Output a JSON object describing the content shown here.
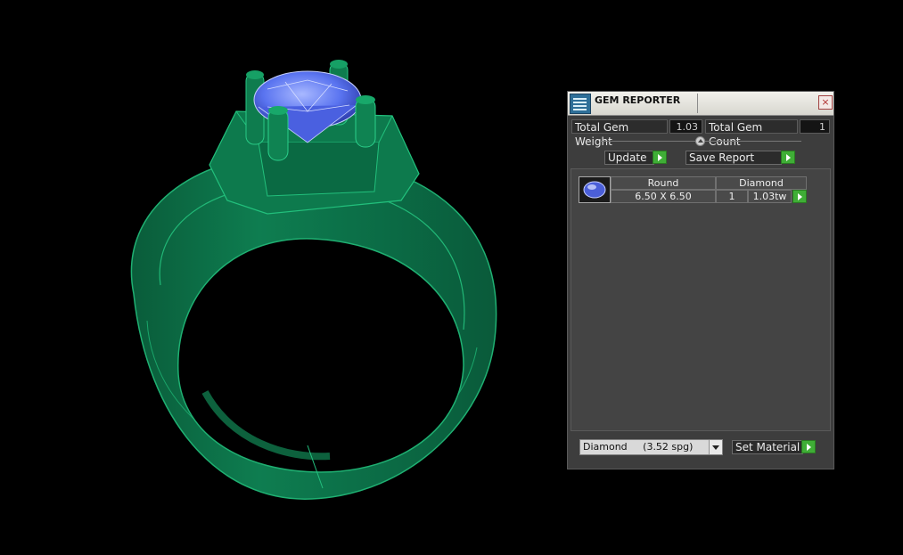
{
  "window": {
    "title": "GEM REPORTER",
    "close_label": "×"
  },
  "summary": {
    "weight_label": "Total Gem Weight",
    "weight_value": "1.03",
    "count_label": "Total Gem Count",
    "count_value": "1"
  },
  "actions": {
    "update_label": "Update",
    "save_label": "Save Report"
  },
  "table": {
    "headers": [
      "Round",
      "Diamond"
    ],
    "rows": [
      {
        "size": "6.50 X 6.50",
        "count": "1",
        "weight": "1.03tw"
      }
    ]
  },
  "material": {
    "selected": "Diamond     (3.52 spg)",
    "set_label": "Set Material"
  },
  "colors": {
    "ring": "#0c7a4f",
    "gem": "#4b6cf0",
    "button_green": "#3fae36"
  }
}
